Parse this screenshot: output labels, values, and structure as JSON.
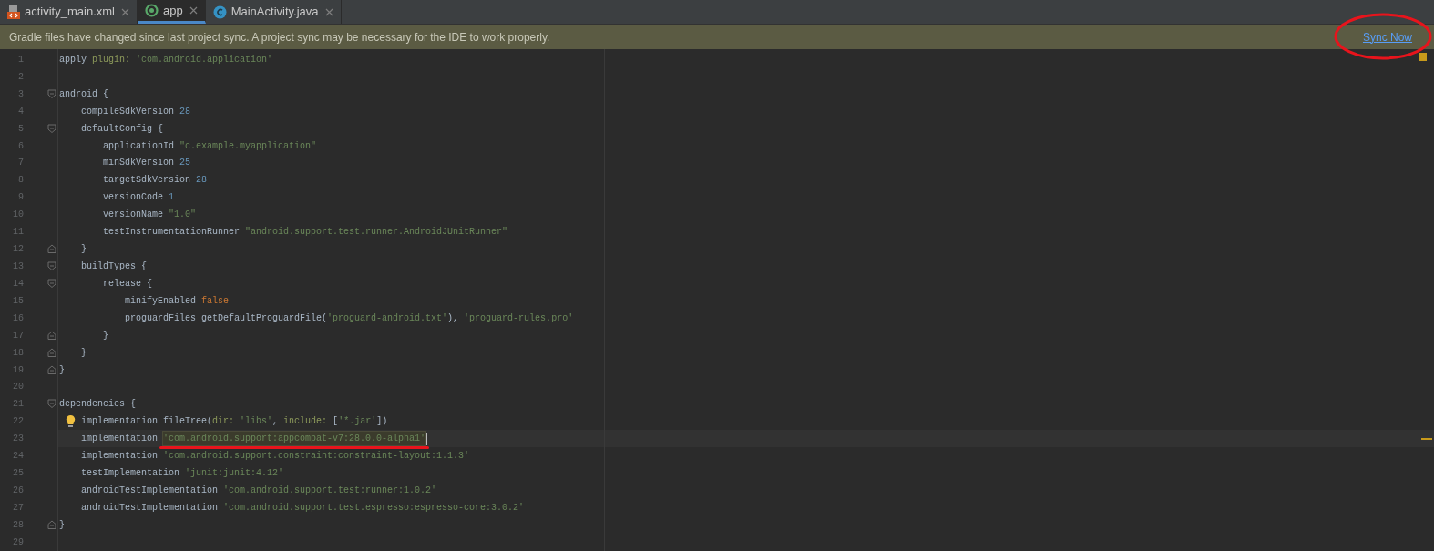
{
  "tabs": [
    {
      "label": "activity_main.xml",
      "kind": "layout",
      "selected": false
    },
    {
      "label": "app",
      "kind": "gradle",
      "selected": true
    },
    {
      "label": "MainActivity.java",
      "kind": "class",
      "selected": false
    }
  ],
  "banner": {
    "message": "Gradle files have changed since last project sync. A project sync may be necessary for the IDE to work properly.",
    "action": {
      "text": "Sync Now",
      "circled": true
    }
  },
  "editor": {
    "lines": [
      {
        "number": "1",
        "tokens": [
          {
            "text": "apply ",
            "kind": "plain"
          },
          {
            "text": "plugin: ",
            "kind": "named"
          },
          {
            "text": "'com.android.application'",
            "kind": "string"
          }
        ]
      },
      {
        "number": "2"
      },
      {
        "number": "3",
        "fold_start": true,
        "tokens": [
          {
            "text": "android {",
            "kind": "plain"
          }
        ]
      },
      {
        "number": "4",
        "tokens": [
          {
            "text": "    compileSdkVersion ",
            "kind": "plain"
          },
          {
            "text": "28",
            "kind": "number"
          }
        ]
      },
      {
        "number": "5",
        "fold_start": true,
        "tokens": [
          {
            "text": "    defaultConfig {",
            "kind": "plain"
          }
        ]
      },
      {
        "number": "6",
        "tokens": [
          {
            "text": "        applicationId ",
            "kind": "plain"
          },
          {
            "text": "\"c.example.myapplication\"",
            "kind": "string"
          }
        ]
      },
      {
        "number": "7",
        "tokens": [
          {
            "text": "        minSdkVersion ",
            "kind": "plain"
          },
          {
            "text": "25",
            "kind": "number"
          }
        ]
      },
      {
        "number": "8",
        "tokens": [
          {
            "text": "        targetSdkVersion ",
            "kind": "plain"
          },
          {
            "text": "28",
            "kind": "number"
          }
        ]
      },
      {
        "number": "9",
        "tokens": [
          {
            "text": "        versionCode ",
            "kind": "plain"
          },
          {
            "text": "1",
            "kind": "number"
          }
        ]
      },
      {
        "number": "10",
        "tokens": [
          {
            "text": "        versionName ",
            "kind": "plain"
          },
          {
            "text": "\"1.0\"",
            "kind": "string"
          }
        ]
      },
      {
        "number": "11",
        "tokens": [
          {
            "text": "        testInstrumentationRunner ",
            "kind": "plain"
          },
          {
            "text": "\"android.support.test.runner.AndroidJUnitRunner\"",
            "kind": "string"
          }
        ]
      },
      {
        "number": "12",
        "fold_end": true,
        "tokens": [
          {
            "text": "    }",
            "kind": "plain"
          }
        ]
      },
      {
        "number": "13",
        "fold_start": true,
        "tokens": [
          {
            "text": "    buildTypes {",
            "kind": "plain"
          }
        ]
      },
      {
        "number": "14",
        "fold_start": true,
        "tokens": [
          {
            "text": "        release {",
            "kind": "plain"
          }
        ]
      },
      {
        "number": "15",
        "tokens": [
          {
            "text": "            minifyEnabled ",
            "kind": "plain"
          },
          {
            "text": "false",
            "kind": "keyword"
          }
        ]
      },
      {
        "number": "16",
        "tokens": [
          {
            "text": "            proguardFiles getDefaultProguardFile(",
            "kind": "plain"
          },
          {
            "text": "'proguard-android.txt'",
            "kind": "string"
          },
          {
            "text": "), ",
            "kind": "plain"
          },
          {
            "text": "'proguard-rules.pro'",
            "kind": "string"
          }
        ]
      },
      {
        "number": "17",
        "fold_end": true,
        "tokens": [
          {
            "text": "        }",
            "kind": "plain"
          }
        ]
      },
      {
        "number": "18",
        "fold_end": true,
        "tokens": [
          {
            "text": "    }",
            "kind": "plain"
          }
        ]
      },
      {
        "number": "19",
        "fold_end": true,
        "tokens": [
          {
            "text": "}",
            "kind": "plain"
          }
        ]
      },
      {
        "number": "20"
      },
      {
        "number": "21",
        "fold_start": true,
        "tokens": [
          {
            "text": "dependencies {",
            "kind": "plain"
          }
        ]
      },
      {
        "number": "22",
        "bulb": true,
        "tokens": [
          {
            "text": "    implementation fileTree(",
            "kind": "plain"
          },
          {
            "text": "dir: ",
            "kind": "named"
          },
          {
            "text": "'libs'",
            "kind": "string"
          },
          {
            "text": ", ",
            "kind": "plain"
          },
          {
            "text": "include: ",
            "kind": "named"
          },
          {
            "text": "[",
            "kind": "plain"
          },
          {
            "text": "'*.jar'",
            "kind": "string"
          },
          {
            "text": "])",
            "kind": "plain"
          }
        ]
      },
      {
        "number": "23",
        "current": true,
        "tokens": [
          {
            "text": "    implementation ",
            "kind": "plain"
          },
          {
            "text": "'com.android.support:appcompat-v7:28.0.0-alpha1'",
            "kind": "string",
            "marked": true
          }
        ]
      },
      {
        "number": "24",
        "tokens": [
          {
            "text": "    implementation ",
            "kind": "plain"
          },
          {
            "text": "'com.android.support.constraint:constraint-layout:1.1.3'",
            "kind": "string"
          }
        ]
      },
      {
        "number": "25",
        "tokens": [
          {
            "text": "    testImplementation ",
            "kind": "plain"
          },
          {
            "text": "'junit:junit:4.12'",
            "kind": "string"
          }
        ]
      },
      {
        "number": "26",
        "tokens": [
          {
            "text": "    androidTestImplementation ",
            "kind": "plain"
          },
          {
            "text": "'com.android.support.test:runner:1.0.2'",
            "kind": "string"
          }
        ]
      },
      {
        "number": "27",
        "tokens": [
          {
            "text": "    androidTestImplementation ",
            "kind": "plain"
          },
          {
            "text": "'com.android.support.test.espresso:espresso-core:3.0.2'",
            "kind": "string"
          }
        ]
      },
      {
        "number": "28",
        "fold_end": true,
        "tokens": [
          {
            "text": "}",
            "kind": "plain"
          }
        ]
      },
      {
        "number": "29"
      }
    ]
  }
}
